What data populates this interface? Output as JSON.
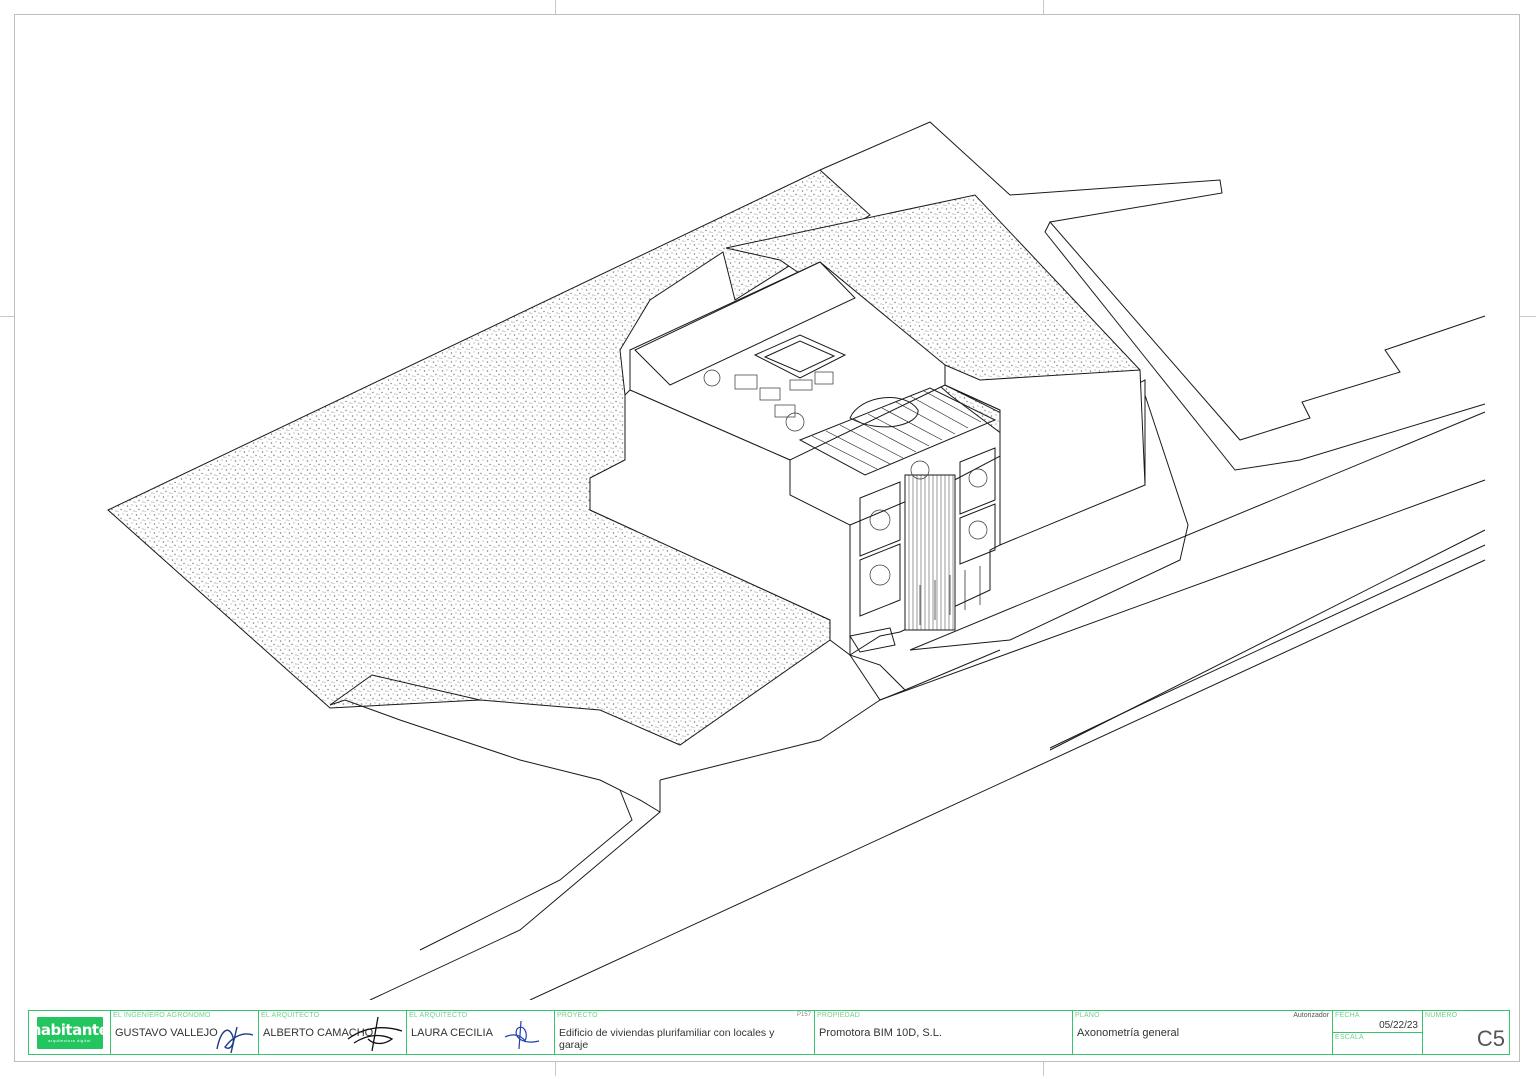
{
  "title_block": {
    "logo": {
      "name": "habitante",
      "tagline": "arquitectura digital"
    },
    "engineer": {
      "label": "EL INGENIERO AGRÓNOMO",
      "name": "GUSTAVO VALLEJO"
    },
    "architect1": {
      "label": "EL ARQUITECTO",
      "name": "ALBERTO CAMACHO"
    },
    "architect2": {
      "label": "EL ARQUITECTO",
      "name": "LAURA CECILIA"
    },
    "project": {
      "label": "PROYECTO",
      "code": "P157",
      "value": "Edificio de viviendas plurifamiliar con locales y garaje"
    },
    "owner": {
      "label": "PROPIEDAD",
      "value": "Promotora BIM 10D, S.L."
    },
    "plan": {
      "label": "PLANO",
      "value": "Axonometría general",
      "status": "Autorizador"
    },
    "date": {
      "label": "FECHA",
      "value": "05/22/23",
      "scale_label": "ESCALA",
      "scale_value": ""
    },
    "number": {
      "label": "NUMERO",
      "value": "C5"
    }
  },
  "colors": {
    "title_block_border": "#38c46a",
    "logo_bg": "#22c55e",
    "line": "#1a1a1a",
    "hatch": "#8a8a8a"
  }
}
